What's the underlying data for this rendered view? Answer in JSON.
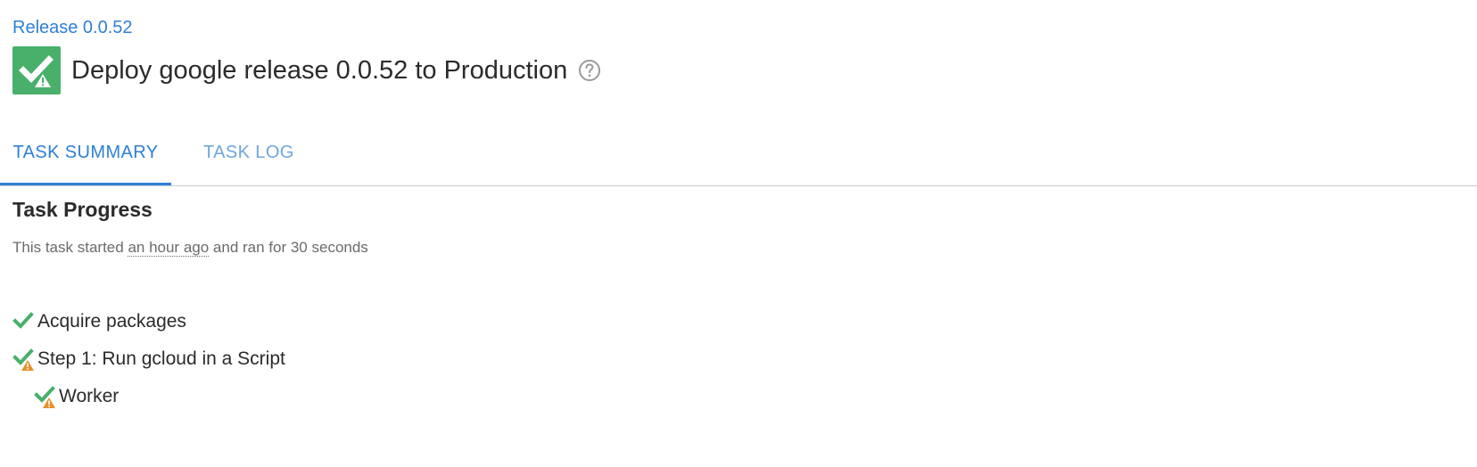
{
  "breadcrumb": "Release 0.0.52",
  "page_title": "Deploy google release 0.0.52 to Production",
  "tabs": [
    {
      "label": "TASK SUMMARY",
      "active": true
    },
    {
      "label": "TASK LOG",
      "active": false
    }
  ],
  "progress": {
    "heading": "Task Progress",
    "summary_prefix": "This task started ",
    "started": "an hour ago",
    "summary_suffix": " and ran for 30 seconds"
  },
  "tasks": [
    {
      "label": "Acquire packages",
      "status": "success"
    },
    {
      "label": "Step 1: Run gcloud in a Script",
      "status": "success-with-warning"
    },
    {
      "label": "Worker",
      "status": "success-with-warning"
    }
  ],
  "colors": {
    "accent": "#2f80d4",
    "success": "#48b06a",
    "warning": "#e8902c"
  },
  "icons": {
    "status": "success-with-warning-icon",
    "help": "help-circle-icon"
  }
}
